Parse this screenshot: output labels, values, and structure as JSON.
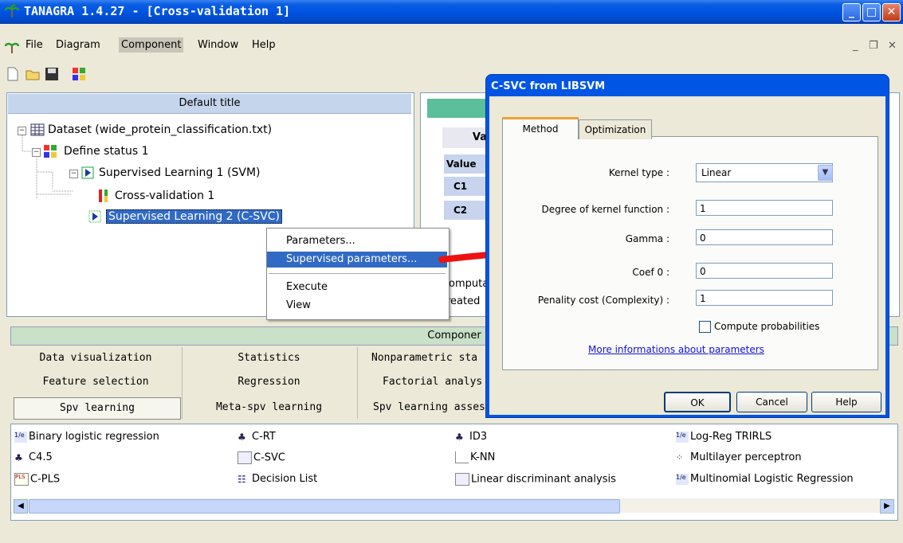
{
  "window": {
    "title": "TANAGRA 1.4.27 - [Cross-validation 1]"
  },
  "menu": [
    "File",
    "Diagram",
    "Component",
    "Window",
    "Help"
  ],
  "tree": {
    "header": "Default title",
    "dataset": "Dataset (wide_protein_classification.txt)",
    "define_status": "Define status 1",
    "sl1": "Supervised Learning 1 (SVM)",
    "cv": "Cross-validation 1",
    "sl2": "Supervised Learning 2 (C-SVC)"
  },
  "context_menu": [
    "Parameters...",
    "Supervised parameters...",
    "Execute",
    "View"
  ],
  "right_panel": {
    "va": "Va",
    "value": "Value",
    "c1": "C1",
    "c2": "C2",
    "comput": "omputa",
    "created": "reated"
  },
  "components": {
    "header": "Componer",
    "tabs_row1": [
      "Data visualization",
      "Statistics",
      "Nonparametric sta"
    ],
    "tabs_row2": [
      "Feature selection",
      "Regression",
      "Factorial analys"
    ],
    "tabs_row3": [
      "Spv learning",
      "Meta-spv learning",
      "Spv learning assess"
    ],
    "tools": [
      [
        "Binary logistic regression",
        "C-RT",
        "ID3",
        "Log-Reg TRIRLS"
      ],
      [
        "C4.5",
        "C-SVC",
        "K-NN",
        "Multilayer perceptron"
      ],
      [
        "C-PLS",
        "Decision List",
        "Linear discriminant analysis",
        "Multinomial Logistic Regression"
      ]
    ]
  },
  "dialog": {
    "title": "C-SVC from LIBSVM",
    "tab_method": "Method",
    "tab_optimization": "Optimization",
    "kernel_label": "Kernel type :",
    "kernel_value": "Linear",
    "degree_label": "Degree of kernel function :",
    "degree_value": "1",
    "gamma_label": "Gamma :",
    "gamma_value": "0",
    "coef_label": "Coef 0 :",
    "coef_value": "0",
    "cost_label": "Penality cost (Complexity) :",
    "cost_value": "1",
    "prob_label": "Compute probabilities",
    "link": "More informations about parameters",
    "ok": "OK",
    "cancel": "Cancel",
    "help": "Help"
  },
  "colors": {
    "arrow": "#ee1111",
    "title_bar": "#0054e3",
    "selection": "#316ac5"
  }
}
